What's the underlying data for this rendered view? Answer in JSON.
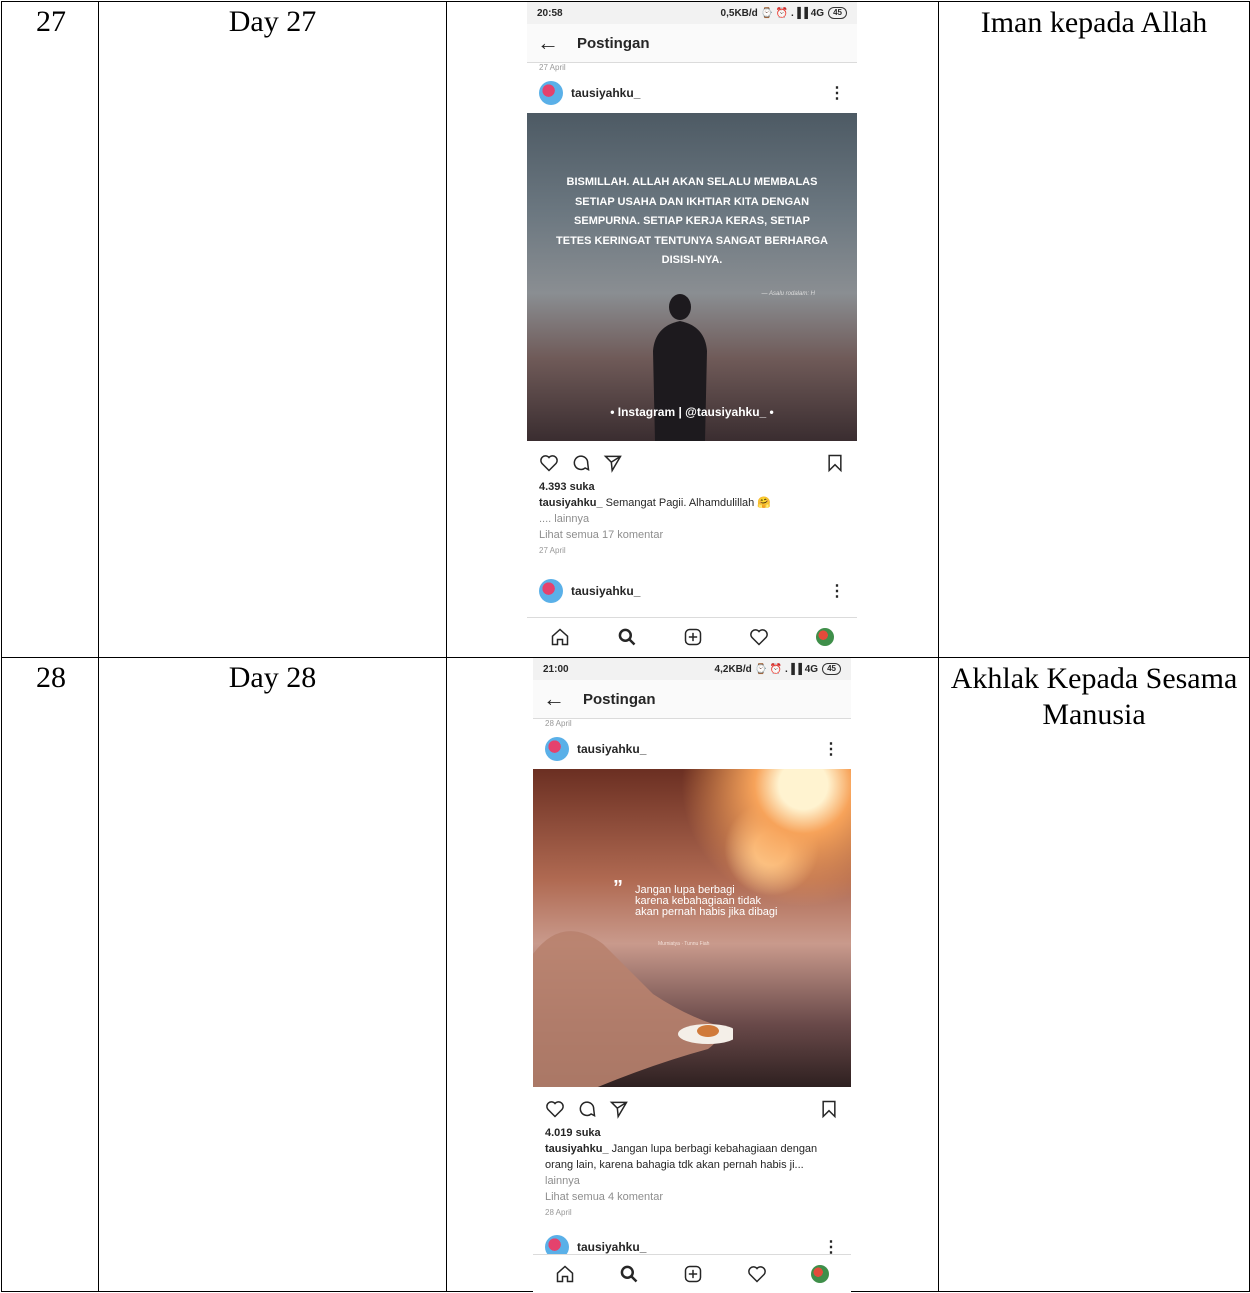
{
  "rows": [
    {
      "number": "27",
      "day": "Day 27",
      "topic": "Iman kepada Allah",
      "screenshot": {
        "status_time": "20:58",
        "status_right": "0,5KB/d ⌚ ⏰ .▐▐ 4G",
        "battery": "45",
        "nav_title": "Postingan",
        "date_top": "27 April",
        "username": "tausiyahku_",
        "image_quote": "BISMILLAH. ALLAH AKAN SELALU MEMBALAS SETIAP USAHA DAN IKHTIAR KITA DENGAN SEMPURNA. SETIAP KERJA KERAS, SETIAP TETES KERINGAT TENTUNYA SANGAT BERHARGA DISISI-NYA.",
        "image_signature": "— Asalu rodalam: H",
        "image_watermark": "• Instagram | @tausiyahku_ •",
        "likes": "4.393 suka",
        "caption_user": "tausiyahku_",
        "caption_text": "Semangat Pagii. Alhamdulillah 🤗",
        "more": ".... lainnya",
        "comments": "Lihat semua 17 komentar",
        "date": "27 April",
        "next_username": "tausiyahku_"
      }
    },
    {
      "number": "28",
      "day": "Day 28",
      "topic": "Akhlak Kepada Sesama Manusia",
      "screenshot": {
        "status_time": "21:00",
        "status_right": "4,2KB/d ⌚ ⏰ .▐▐ 4G",
        "battery": "45",
        "nav_title": "Postingan",
        "date_top": "28 April",
        "username": "tausiyahku_",
        "image_quote_1": "Jangan lupa berbagi",
        "image_quote_2": "karena kebahagiaan tidak",
        "image_quote_3": "akan pernah habis jika dibagi",
        "image_signature": "Murniatya · Tunnu Fiah",
        "likes": "4.019 suka",
        "caption_user": "tausiyahku_",
        "caption_text": "Jangan lupa berbagi kebahagiaan dengan orang lain, karena bahagia tdk akan pernah habis ji...",
        "more": "lainnya",
        "comments": "Lihat semua 4 komentar",
        "date": "28 April",
        "next_username": "tausiyahku_"
      }
    }
  ]
}
